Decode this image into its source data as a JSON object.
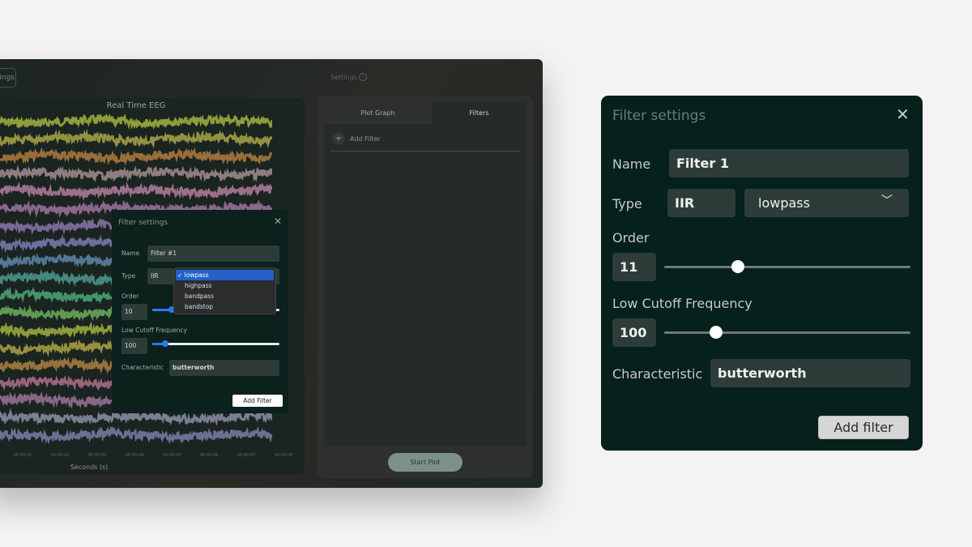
{
  "app": {
    "top_button": "Settings",
    "settings_label": "Settings",
    "plot": {
      "title": "Real Time EEG",
      "x_label": "Seconds (s)",
      "ticks": [
        "00:00:01",
        "00:00:02",
        "00:00:03",
        "00:00:04",
        "00:00:05",
        "00:00:06",
        "00:00:07",
        "00:00:08"
      ],
      "trace_colors": [
        "#a2b43e",
        "#aaa547",
        "#b07b3e",
        "#a48e90",
        "#b47e9a",
        "#a0739f",
        "#8c76a8",
        "#7a7cb0",
        "#5e86a8",
        "#4e9a8e",
        "#4fa877",
        "#6cae5a",
        "#a0b23e",
        "#aea544",
        "#ae8042",
        "#b0708a",
        "#9a7498",
        "#8e8ea6",
        "#7c7ea6"
      ]
    },
    "tabs": [
      {
        "label": "Plot Graph",
        "active": false
      },
      {
        "label": "Filters",
        "active": true
      }
    ],
    "add_filter": "Add Filter",
    "start_plot": "Start Plot",
    "small_modal": {
      "title": "Filter settings",
      "name_label": "Name",
      "name_value": "Filter #1",
      "type_label": "Type",
      "type_value": "IIR",
      "type_options": [
        {
          "label": "lowpass",
          "selected": true
        },
        {
          "label": "highpass"
        },
        {
          "label": "bandpass"
        },
        {
          "label": "bandstop"
        }
      ],
      "order_label": "Order",
      "order_value": "10",
      "order_fraction": 0.15,
      "low_cutoff_label": "Low Cutoff Frequency",
      "low_cutoff_value": "100",
      "low_cutoff_fraction": 0.1,
      "characteristic_label": "Characteristic",
      "characteristic_value": "butterworth",
      "add_button": "Add Filter"
    }
  },
  "filter_settings": {
    "title": "Filter settings",
    "name_label": "Name",
    "name_value": "Filter 1",
    "type_label": "Type",
    "type_value": "IIR",
    "subtype_value": "lowpass",
    "order_label": "Order",
    "order_value": "11",
    "order_fraction": 0.3,
    "low_cutoff_label": "Low Cutoff Frequency",
    "low_cutoff_value": "100",
    "low_cutoff_fraction": 0.21,
    "characteristic_label": "Characteristic",
    "characteristic_value": "butterworth",
    "add_button": "Add filter"
  }
}
